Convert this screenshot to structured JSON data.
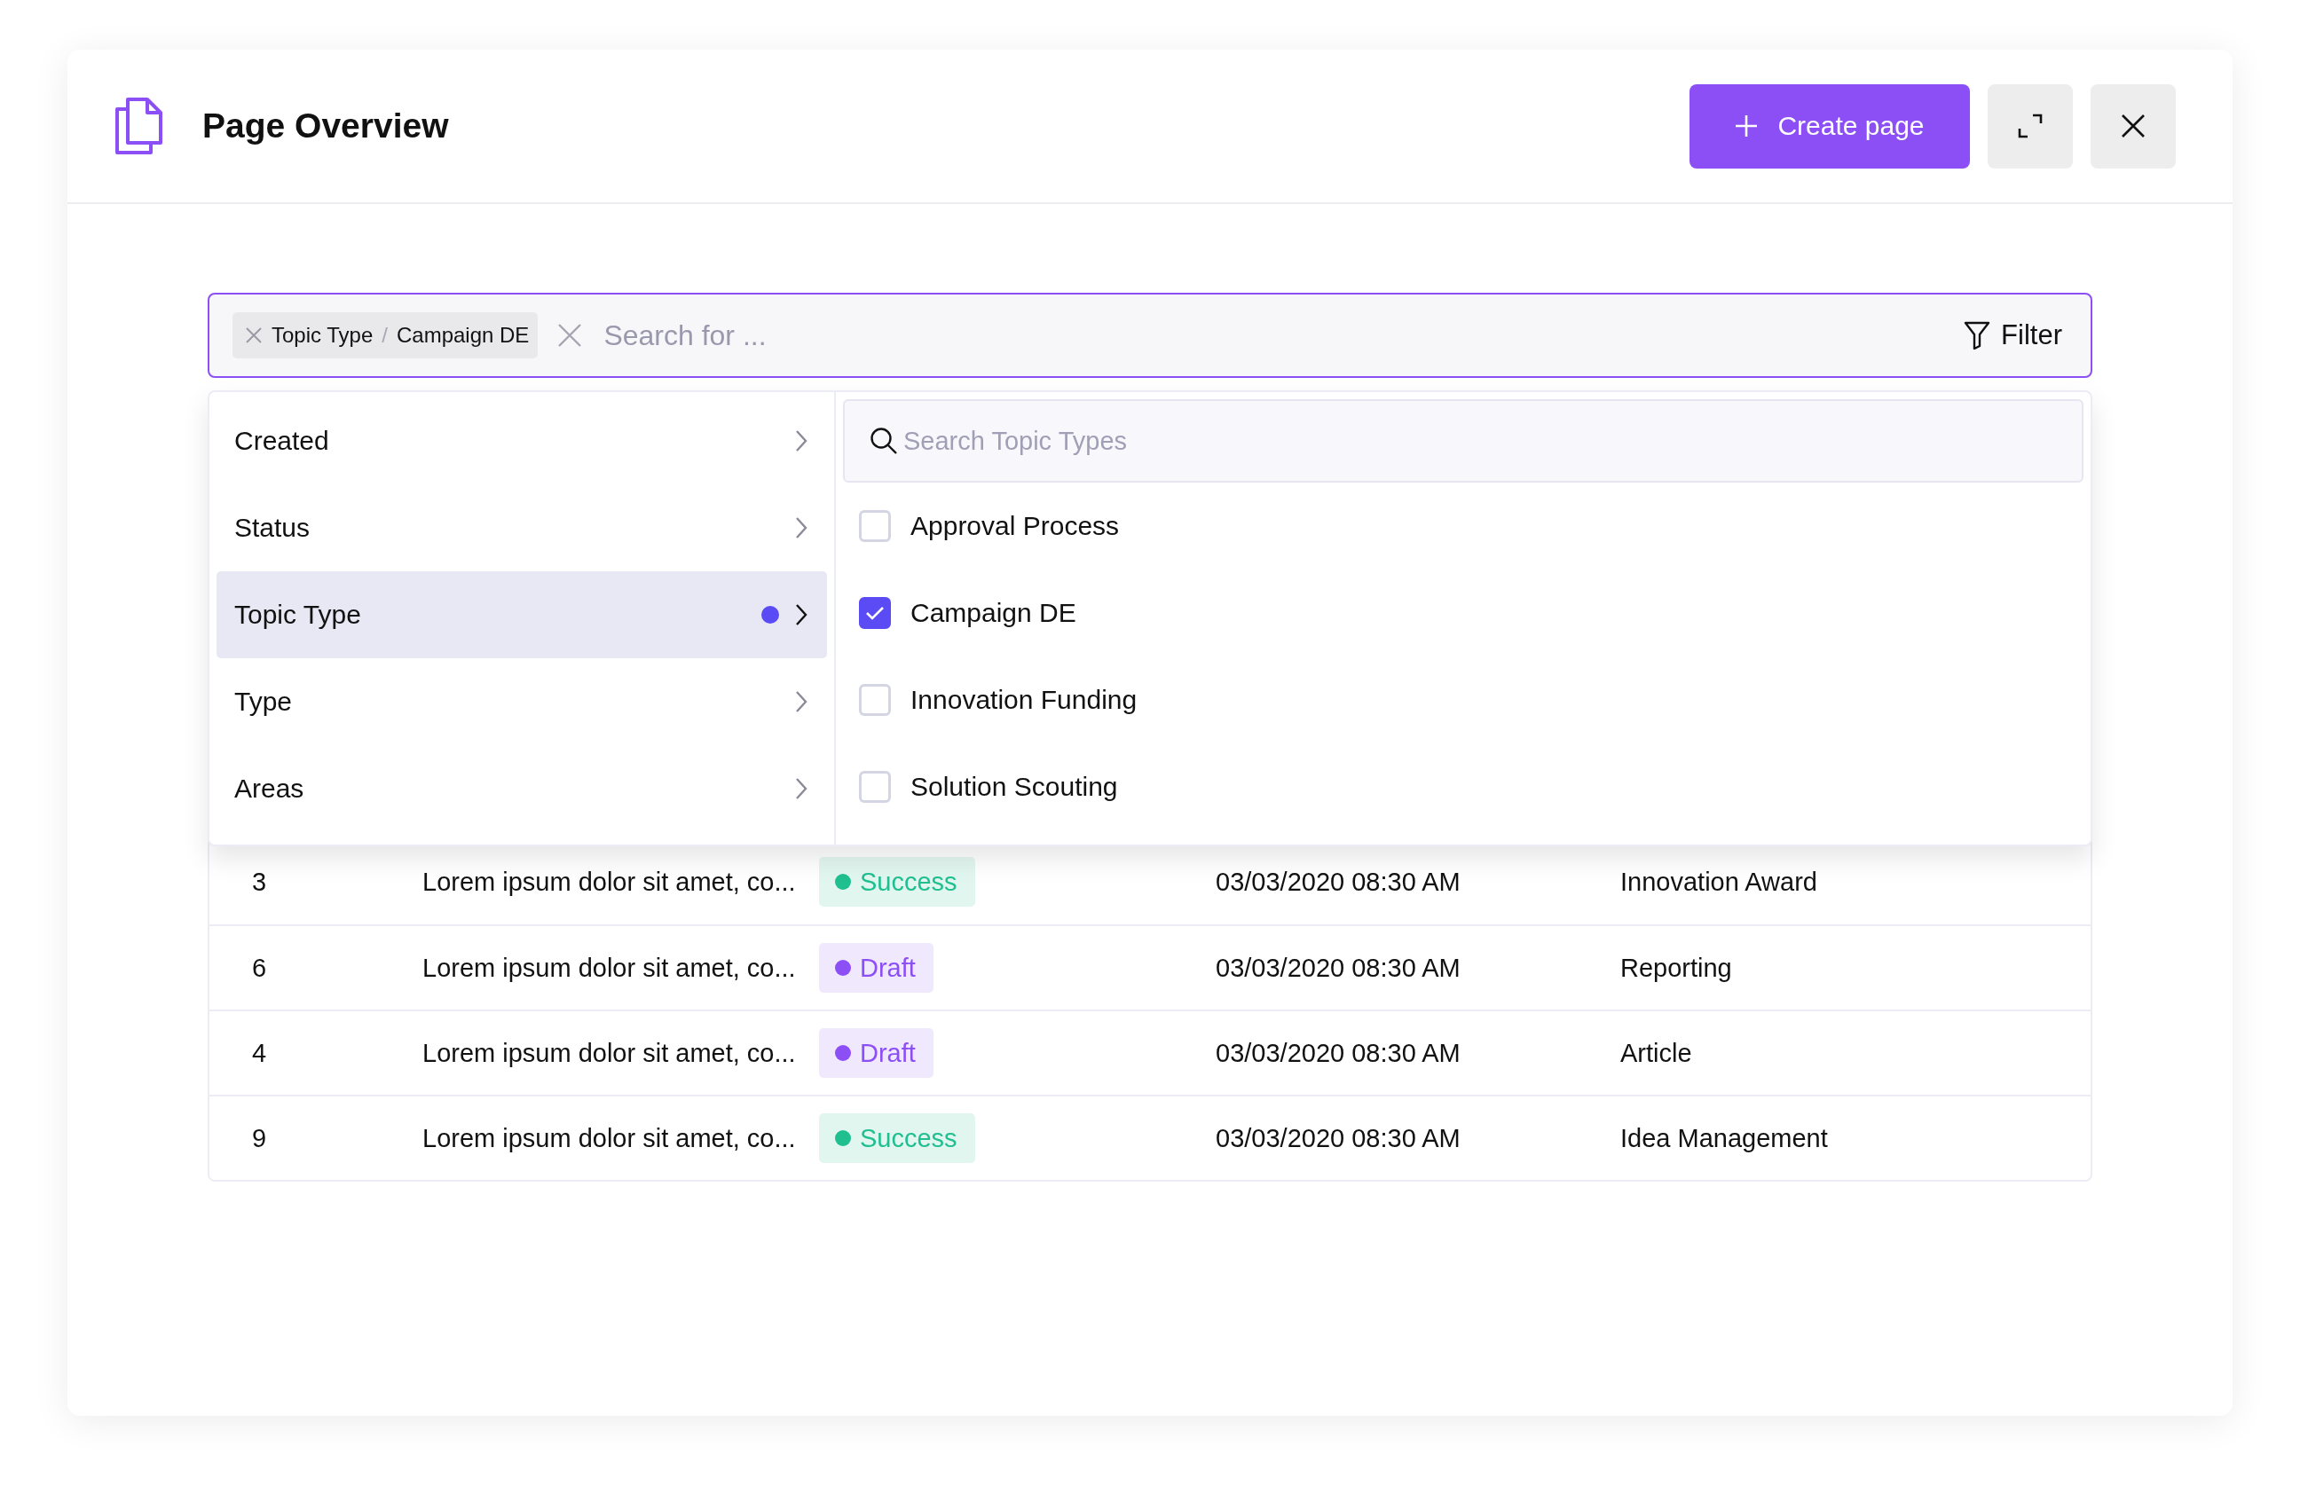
{
  "header": {
    "title": "Page Overview",
    "create_button": "Create page"
  },
  "search": {
    "chip": {
      "group": "Topic Type",
      "separator": "/",
      "value": "Campaign DE"
    },
    "placeholder": "Search for ...",
    "filter_label": "Filter"
  },
  "filter_menu": {
    "categories": [
      {
        "label": "Created",
        "selected": false,
        "active_filter": false
      },
      {
        "label": "Status",
        "selected": false,
        "active_filter": false
      },
      {
        "label": "Topic Type",
        "selected": true,
        "active_filter": true
      },
      {
        "label": "Type",
        "selected": false,
        "active_filter": false
      },
      {
        "label": "Areas",
        "selected": false,
        "active_filter": false
      }
    ],
    "option_search": {
      "placeholder": "Search Topic Types"
    },
    "options": [
      {
        "label": "Approval Process",
        "checked": false
      },
      {
        "label": "Campaign DE",
        "checked": true
      },
      {
        "label": "Innovation Funding",
        "checked": false
      },
      {
        "label": "Solution Scouting",
        "checked": false
      }
    ]
  },
  "table": {
    "rows": [
      {
        "id": "3",
        "title": "Lorem ipsum dolor sit amet, co...",
        "status": {
          "kind": "success",
          "label": "Success"
        },
        "date": "03/03/2020 08:30 AM",
        "topic": "Innovation Award"
      },
      {
        "id": "6",
        "title": "Lorem ipsum dolor sit amet, co...",
        "status": {
          "kind": "draft",
          "label": "Draft"
        },
        "date": "03/03/2020 08:30 AM",
        "topic": "Reporting"
      },
      {
        "id": "4",
        "title": "Lorem ipsum dolor sit amet, co...",
        "status": {
          "kind": "draft",
          "label": "Draft"
        },
        "date": "03/03/2020 08:30 AM",
        "topic": "Article"
      },
      {
        "id": "9",
        "title": "Lorem ipsum dolor sit amet, co...",
        "status": {
          "kind": "success",
          "label": "Success"
        },
        "date": "03/03/2020 08:30 AM",
        "topic": "Idea Management"
      }
    ]
  }
}
